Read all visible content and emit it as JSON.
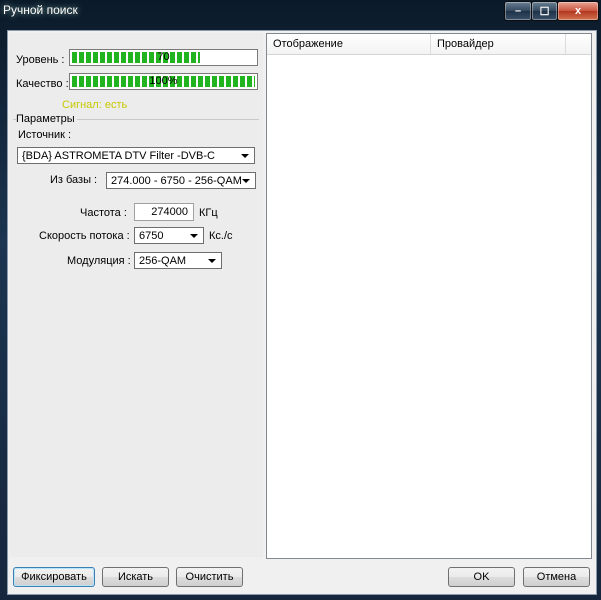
{
  "window": {
    "title": "Ручной поиск",
    "minimize_label": "–",
    "maximize_label": "☐",
    "close_label": "x"
  },
  "signal": {
    "level_label": "Уровень :",
    "level_value": 70,
    "level_text": "70",
    "quality_label": "Качество :",
    "quality_value": 100,
    "quality_text": "100%",
    "status_text": "Сигнал: есть"
  },
  "params": {
    "group_title": "Параметры",
    "source_label": "Источник :",
    "source_value": "{BDA} ASTROMETA DTV Filter -DVB-C",
    "db_label": "Из базы :",
    "db_value": "274.000 - 6750 - 256-QAM",
    "freq_label": "Частота :",
    "freq_value": "274000",
    "freq_unit": "КГц",
    "rate_label": "Скорость потока :",
    "rate_value": "6750",
    "rate_unit": "Кс./с",
    "mod_label": "Модуляция :",
    "mod_value": "256-QAM"
  },
  "list": {
    "columns": [
      "Отображение",
      "Провайдер"
    ],
    "rows": []
  },
  "buttons": {
    "fix": "Фиксировать",
    "search": "Искать",
    "clear": "Очистить",
    "ok": "OK",
    "cancel": "Отмена"
  },
  "colors": {
    "bar_fill": "#22b41f",
    "signal_text": "#c8c800",
    "titlebar": "#1c3550"
  }
}
